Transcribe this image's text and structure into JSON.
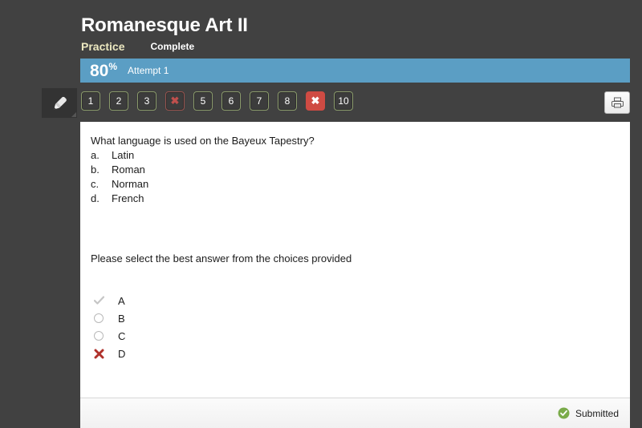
{
  "header": {
    "title": "Romanesque Art II",
    "status_practice": "Practice",
    "status_complete": "Complete"
  },
  "score": {
    "value": "80",
    "percent_symbol": "%",
    "attempt_label": "Attempt 1",
    "bar_color": "#5b9ec4"
  },
  "toolbar": {
    "pencil_icon": "pencil-icon",
    "print_icon": "printer-icon"
  },
  "question_nav": {
    "buttons": [
      {
        "label": "1",
        "state": "normal"
      },
      {
        "label": "2",
        "state": "normal"
      },
      {
        "label": "3",
        "state": "normal"
      },
      {
        "label": "✖",
        "state": "wrong"
      },
      {
        "label": "5",
        "state": "normal"
      },
      {
        "label": "6",
        "state": "normal"
      },
      {
        "label": "7",
        "state": "normal"
      },
      {
        "label": "8",
        "state": "normal"
      },
      {
        "label": "✖",
        "state": "active-wrong"
      },
      {
        "label": "10",
        "state": "normal"
      }
    ],
    "border_color": "#8a9a6b",
    "wrong_color": "#cf4b43"
  },
  "question": {
    "stem": "What language is used on the Bayeux Tapestry?",
    "choices": [
      {
        "letter": "a.",
        "text": "Latin"
      },
      {
        "letter": "b.",
        "text": "Roman"
      },
      {
        "letter": "c.",
        "text": "Norman"
      },
      {
        "letter": "d.",
        "text": "French"
      }
    ],
    "instruction": "Please select the best answer from the choices provided"
  },
  "answers": [
    {
      "label": "A",
      "mark": "check"
    },
    {
      "label": "B",
      "mark": "radio"
    },
    {
      "label": "C",
      "mark": "radio"
    },
    {
      "label": "D",
      "mark": "cross"
    }
  ],
  "footer": {
    "status_text": "Submitted",
    "status_icon": "check-circle-icon",
    "status_color": "#7aab4a"
  }
}
